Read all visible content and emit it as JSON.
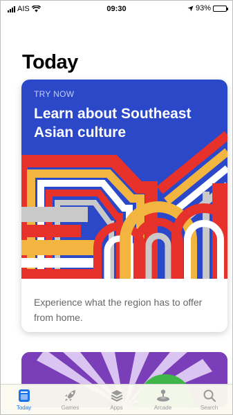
{
  "status_bar": {
    "carrier": "AIS",
    "time": "09:30",
    "battery": "93%"
  },
  "page": {
    "title": "Today"
  },
  "card": {
    "eyebrow": "TRY NOW",
    "title": "Learn about Southeast Asian culture",
    "description": "Experience what the region has to offer from home.",
    "colors": {
      "background": "#2b48c9",
      "red": "#e6322b",
      "yellow": "#f2b640",
      "gray": "#c9c9c9",
      "white": "#ffffff"
    }
  },
  "tabbar": {
    "items": [
      {
        "label": "Today",
        "icon": "today-icon",
        "active": true
      },
      {
        "label": "Games",
        "icon": "rocket-icon",
        "active": false
      },
      {
        "label": "Apps",
        "icon": "layers-icon",
        "active": false
      },
      {
        "label": "Arcade",
        "icon": "joystick-icon",
        "active": false
      },
      {
        "label": "Search",
        "icon": "search-icon",
        "active": false
      }
    ],
    "active_color": "#1a73e8"
  }
}
